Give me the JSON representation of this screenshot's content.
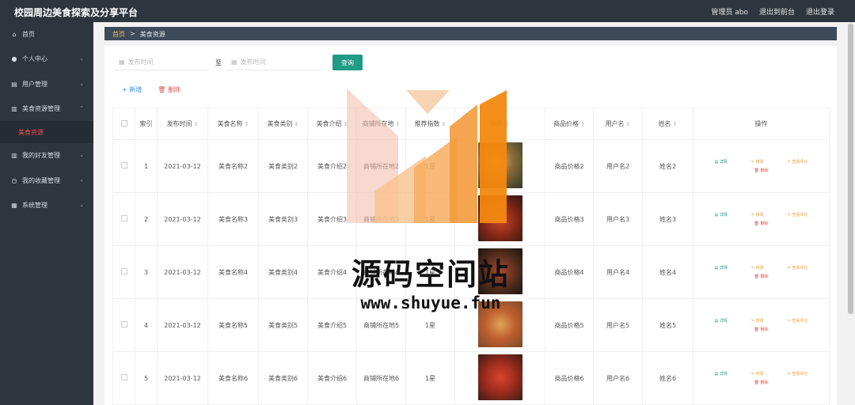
{
  "header": {
    "app_title": "校园周边美食探索及分享平台",
    "admin_label": "管理员 abo",
    "goto_front": "退出到前台",
    "logout": "退出登录"
  },
  "sidebar": {
    "items": [
      {
        "label": "首页",
        "icon": "home-icon",
        "glyph": "⌂",
        "chevron": ""
      },
      {
        "label": "个人中心",
        "icon": "user-icon",
        "glyph": "●",
        "chevron": "⌄"
      },
      {
        "label": "用户管理",
        "icon": "briefcase-icon",
        "glyph": "▤",
        "chevron": "⌄"
      },
      {
        "label": "美食资源管理",
        "icon": "book-icon",
        "glyph": "▥",
        "chevron": "⌃"
      },
      {
        "label": "我的好友管理",
        "icon": "book-icon",
        "glyph": "▥",
        "chevron": "⌄"
      },
      {
        "label": "我的收藏管理",
        "icon": "clock-icon",
        "glyph": "◷",
        "chevron": "⌄"
      },
      {
        "label": "系统管理",
        "icon": "grid-icon",
        "glyph": "▦",
        "chevron": "⌄"
      }
    ],
    "active_sub": "美食资源"
  },
  "breadcrumb": {
    "home": "首页",
    "separator": ">",
    "current": "美食资源"
  },
  "search": {
    "start_placeholder": "发布时间",
    "to_label": "至",
    "end_placeholder": "发布时间",
    "query_button": "查询"
  },
  "actions": {
    "add": "+ 新增",
    "delete": "删除"
  },
  "table": {
    "columns": [
      "索引",
      "发布时间",
      "美食名称",
      "美食类别",
      "美食介绍",
      "商铺所在地",
      "推荐指数",
      "图片",
      "商品价格",
      "用户名",
      "姓名",
      "操作"
    ],
    "op_labels": {
      "detail": "详情",
      "edit": "修改",
      "review": "查看评论",
      "delete": "删除"
    },
    "rows": [
      {
        "index": "1",
        "date": "2021-03-12",
        "name": "美食名称2",
        "category": "美食类别2",
        "intro": "美食介绍2",
        "shop": "商铺所在地2",
        "rating": "1星",
        "price": "商品价格2",
        "username": "用户名2",
        "realname": "姓名2"
      },
      {
        "index": "2",
        "date": "2021-03-12",
        "name": "美食名称3",
        "category": "美食类别3",
        "intro": "美食介绍3",
        "shop": "商铺所在地3",
        "rating": "1星",
        "price": "商品价格3",
        "username": "用户名3",
        "realname": "姓名3"
      },
      {
        "index": "3",
        "date": "2021-03-12",
        "name": "美食名称4",
        "category": "美食类别4",
        "intro": "美食介绍4",
        "shop": "商铺所在地4",
        "rating": "1星",
        "price": "商品价格4",
        "username": "用户名4",
        "realname": "姓名4"
      },
      {
        "index": "4",
        "date": "2021-03-12",
        "name": "美食名称5",
        "category": "美食类别5",
        "intro": "美食介绍5",
        "shop": "商铺所在地5",
        "rating": "1星",
        "price": "商品价格5",
        "username": "用户名5",
        "realname": "姓名5"
      },
      {
        "index": "5",
        "date": "2021-03-12",
        "name": "美食名称6",
        "category": "美食类别6",
        "intro": "美食介绍6",
        "shop": "商铺所在地6",
        "rating": "1星",
        "price": "商品价格6",
        "username": "用户名6",
        "realname": "姓名6"
      }
    ]
  },
  "watermark": {
    "title": "源码空间站",
    "url": "www.shuyue.fun"
  },
  "colors": {
    "sidebar_bg": "#2e353f",
    "accent_green": "#1f9b86",
    "danger_red": "#e2534e",
    "warn_orange": "#e6a23c",
    "link_blue": "#3a8ee6"
  }
}
